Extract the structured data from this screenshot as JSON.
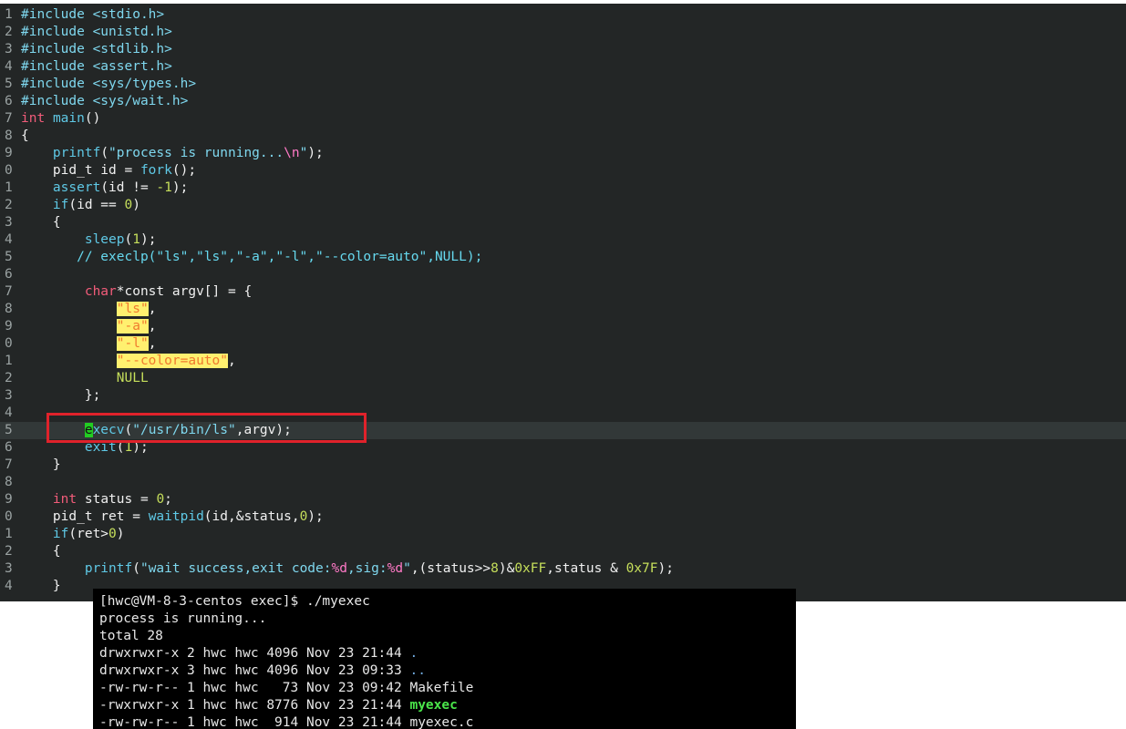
{
  "editor": {
    "lines": [
      {
        "n": "1",
        "parts": [
          {
            "t": "#include ",
            "c": "pp"
          },
          {
            "t": "<stdio.h>",
            "c": "st"
          }
        ]
      },
      {
        "n": "2",
        "parts": [
          {
            "t": "#include ",
            "c": "pp"
          },
          {
            "t": "<unistd.h>",
            "c": "st"
          }
        ]
      },
      {
        "n": "3",
        "parts": [
          {
            "t": "#include ",
            "c": "pp"
          },
          {
            "t": "<stdlib.h>",
            "c": "st"
          }
        ]
      },
      {
        "n": "4",
        "parts": [
          {
            "t": "#include ",
            "c": "pp"
          },
          {
            "t": "<assert.h>",
            "c": "st"
          }
        ]
      },
      {
        "n": "5",
        "parts": [
          {
            "t": "#include ",
            "c": "pp"
          },
          {
            "t": "<sys/types.h>",
            "c": "st"
          }
        ]
      },
      {
        "n": "6",
        "parts": [
          {
            "t": "#include ",
            "c": "pp"
          },
          {
            "t": "<sys/wait.h>",
            "c": "st"
          }
        ]
      },
      {
        "n": "7",
        "parts": [
          {
            "t": "int",
            "c": "ty"
          },
          {
            "t": " "
          },
          {
            "t": "main",
            "c": "fn"
          },
          {
            "t": "()"
          }
        ]
      },
      {
        "n": "8",
        "parts": [
          {
            "t": "{"
          }
        ]
      },
      {
        "n": "9",
        "parts": [
          {
            "t": "    "
          },
          {
            "t": "printf",
            "c": "fn"
          },
          {
            "t": "("
          },
          {
            "t": "\"process is running...",
            "c": "st"
          },
          {
            "t": "\\n",
            "c": "es"
          },
          {
            "t": "\"",
            "c": "st"
          },
          {
            "t": ");"
          }
        ]
      },
      {
        "n": "0",
        "parts": [
          {
            "t": "    pid_t id = "
          },
          {
            "t": "fork",
            "c": "fn"
          },
          {
            "t": "();"
          }
        ]
      },
      {
        "n": "1",
        "parts": [
          {
            "t": "    "
          },
          {
            "t": "assert",
            "c": "fn"
          },
          {
            "t": "(id != "
          },
          {
            "t": "-1",
            "c": "nm"
          },
          {
            "t": ");"
          }
        ]
      },
      {
        "n": "2",
        "parts": [
          {
            "t": "    "
          },
          {
            "t": "if",
            "c": "fn"
          },
          {
            "t": "(id == "
          },
          {
            "t": "0",
            "c": "nm"
          },
          {
            "t": ")"
          }
        ]
      },
      {
        "n": "3",
        "parts": [
          {
            "t": "    {"
          }
        ]
      },
      {
        "n": "4",
        "parts": [
          {
            "t": "        "
          },
          {
            "t": "sleep",
            "c": "fn"
          },
          {
            "t": "("
          },
          {
            "t": "1",
            "c": "nm"
          },
          {
            "t": ");"
          }
        ]
      },
      {
        "n": "5",
        "parts": [
          {
            "t": "       "
          },
          {
            "t": "// execlp(\"ls\",\"ls\",\"-a\",\"-l\",\"--color=auto\",NULL);",
            "c": "cm"
          }
        ]
      },
      {
        "n": "6",
        "parts": []
      },
      {
        "n": "7",
        "parts": [
          {
            "t": "        "
          },
          {
            "t": "char",
            "c": "ty"
          },
          {
            "t": "*const argv[] = {"
          }
        ]
      },
      {
        "n": "8",
        "parts": [
          {
            "t": "            "
          },
          {
            "t": "\"ls\"",
            "c": "hl"
          },
          {
            "t": ","
          }
        ]
      },
      {
        "n": "9",
        "parts": [
          {
            "t": "            "
          },
          {
            "t": "\"-a\"",
            "c": "hl"
          },
          {
            "t": ","
          }
        ]
      },
      {
        "n": "0",
        "parts": [
          {
            "t": "            "
          },
          {
            "t": "\"-l\"",
            "c": "hl"
          },
          {
            "t": ","
          }
        ]
      },
      {
        "n": "1",
        "parts": [
          {
            "t": "            "
          },
          {
            "t": "\"--color=auto\"",
            "c": "hl"
          },
          {
            "t": ","
          }
        ]
      },
      {
        "n": "2",
        "parts": [
          {
            "t": "            "
          },
          {
            "t": "NULL",
            "c": "nm"
          }
        ]
      },
      {
        "n": "3",
        "parts": [
          {
            "t": "        };"
          }
        ]
      },
      {
        "n": "4",
        "parts": []
      },
      {
        "n": "5",
        "cur": true,
        "parts": [
          {
            "t": "        "
          },
          {
            "t": "e",
            "c": "cursor"
          },
          {
            "t": "xecv",
            "c": "fn"
          },
          {
            "t": "("
          },
          {
            "t": "\"/usr/bin/ls\"",
            "c": "st"
          },
          {
            "t": ",argv);"
          }
        ]
      },
      {
        "n": "6",
        "parts": [
          {
            "t": "        "
          },
          {
            "t": "exit",
            "c": "fn"
          },
          {
            "t": "("
          },
          {
            "t": "1",
            "c": "nm"
          },
          {
            "t": ");"
          }
        ]
      },
      {
        "n": "7",
        "parts": [
          {
            "t": "    }"
          }
        ]
      },
      {
        "n": "8",
        "parts": []
      },
      {
        "n": "9",
        "parts": [
          {
            "t": "    "
          },
          {
            "t": "int",
            "c": "ty"
          },
          {
            "t": " status = "
          },
          {
            "t": "0",
            "c": "nm"
          },
          {
            "t": ";"
          }
        ]
      },
      {
        "n": "0",
        "parts": [
          {
            "t": "    pid_t ret = "
          },
          {
            "t": "waitpid",
            "c": "fn"
          },
          {
            "t": "(id,&status,"
          },
          {
            "t": "0",
            "c": "nm"
          },
          {
            "t": ");"
          }
        ]
      },
      {
        "n": "1",
        "parts": [
          {
            "t": "    "
          },
          {
            "t": "if",
            "c": "fn"
          },
          {
            "t": "(ret>"
          },
          {
            "t": "0",
            "c": "nm"
          },
          {
            "t": ")"
          }
        ]
      },
      {
        "n": "2",
        "parts": [
          {
            "t": "    {"
          }
        ]
      },
      {
        "n": "3",
        "parts": [
          {
            "t": "        "
          },
          {
            "t": "printf",
            "c": "fn"
          },
          {
            "t": "("
          },
          {
            "t": "\"wait success,exit code:",
            "c": "st"
          },
          {
            "t": "%d",
            "c": "es"
          },
          {
            "t": ",sig:",
            "c": "st"
          },
          {
            "t": "%d",
            "c": "es"
          },
          {
            "t": "\"",
            "c": "st"
          },
          {
            "t": ",(status>>"
          },
          {
            "t": "8",
            "c": "nm"
          },
          {
            "t": ")&"
          },
          {
            "t": "0xFF",
            "c": "nm"
          },
          {
            "t": ",status & "
          },
          {
            "t": "0x7F",
            "c": "nm"
          },
          {
            "t": ");"
          }
        ]
      },
      {
        "n": "4",
        "parts": [
          {
            "t": "    }"
          }
        ]
      }
    ]
  },
  "terminal": {
    "lines": [
      {
        "parts": [
          {
            "t": "[hwc@VM-8-3-centos exec]$ ./myexec"
          }
        ]
      },
      {
        "parts": [
          {
            "t": "process is running..."
          }
        ]
      },
      {
        "parts": [
          {
            "t": "total 28"
          }
        ]
      },
      {
        "parts": [
          {
            "t": "drwxrwxr-x 2 hwc hwc 4096 Nov 23 21:44 "
          },
          {
            "t": ".",
            "c": "dir"
          }
        ]
      },
      {
        "parts": [
          {
            "t": "drwxrwxr-x 3 hwc hwc 4096 Nov 23 09:33 "
          },
          {
            "t": "..",
            "c": "dir"
          }
        ]
      },
      {
        "parts": [
          {
            "t": "-rw-rw-r-- 1 hwc hwc   73 Nov 23 09:42 Makefile"
          }
        ]
      },
      {
        "parts": [
          {
            "t": "-rwxrwxr-x 1 hwc hwc 8776 Nov 23 21:44 "
          },
          {
            "t": "myexec",
            "c": "exe"
          }
        ]
      },
      {
        "parts": [
          {
            "t": "-rw-rw-r-- 1 hwc hwc  914 Nov 23 21:44 myexec.c"
          }
        ]
      }
    ]
  }
}
